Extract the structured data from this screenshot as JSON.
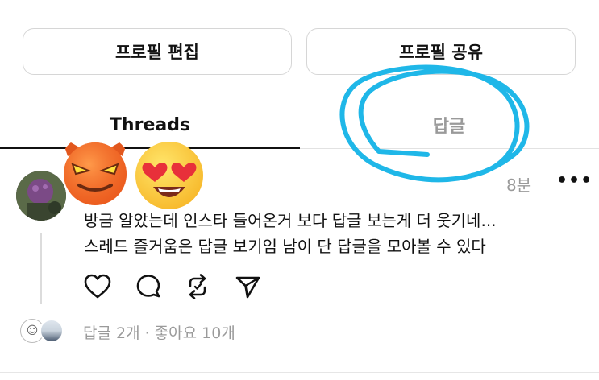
{
  "profile_buttons": {
    "edit_label": "프로필 편집",
    "share_label": "프로필 공유"
  },
  "tabs": [
    {
      "label": "Threads",
      "active": true
    },
    {
      "label": "답글",
      "active": false
    }
  ],
  "post": {
    "time": "8분",
    "more": "•••",
    "text_lines": [
      "방금 알았는데 인스타 들어온거 보다 답글 보는게 더 웃기네...",
      "스레드 즐거움은 답글 보기임 남이 단 답글을 모아볼 수 있다"
    ],
    "actions": [
      "heart-icon",
      "comment-icon",
      "repost-icon",
      "send-icon"
    ],
    "stats": "답글 2개 · 좋아요 10개"
  },
  "annotation_color": "#1fb7e8",
  "colors": {
    "text": "#111111",
    "muted": "#9a9a9a",
    "border": "#d6d6d6"
  }
}
